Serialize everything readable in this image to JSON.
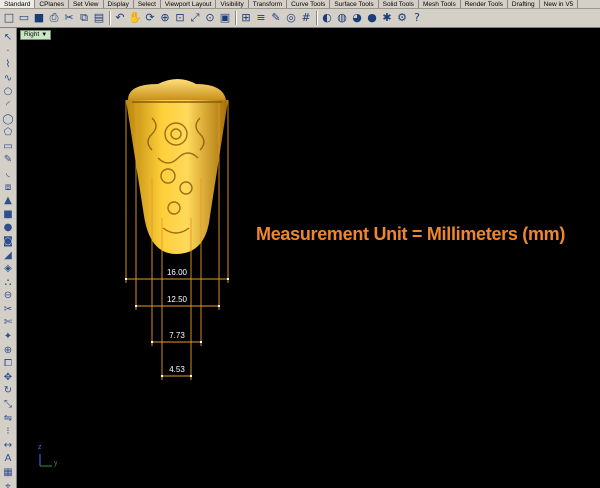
{
  "tabs": [
    "Standard",
    "CPlanes",
    "Set View",
    "Display",
    "Select",
    "Viewport Layout",
    "Visibility",
    "Transform",
    "Curve Tools",
    "Surface Tools",
    "Solid Tools",
    "Mesh Tools",
    "Render Tools",
    "Drafting",
    "New in V5"
  ],
  "active_tab": "Standard",
  "toolbar_icons": [
    "new-icon",
    "open-icon",
    "save-icon",
    "print-icon",
    "cut-icon",
    "copy-icon",
    "paste-icon",
    "undo-icon",
    "pan-icon",
    "rotate-view-icon",
    "zoom-icon",
    "zoom-window-icon",
    "zoom-extents-icon",
    "zoom-selected-icon",
    "viewport-icon",
    "four-view-icon",
    "layer-icon",
    "properties-icon",
    "osnap-icon",
    "grid-icon",
    "render-icon",
    "material-icon",
    "color-icon",
    "sphere-icon",
    "light-icon",
    "options-icon",
    "help-icon"
  ],
  "viewport": {
    "name": "Right",
    "caption": "Measurement Unit = Millimeters (mm)",
    "caption_color": "#f0862a",
    "axis_x": "y",
    "axis_y": "z"
  },
  "dimensions": [
    "16.00",
    "12.50",
    "7.73",
    "4.53"
  ]
}
